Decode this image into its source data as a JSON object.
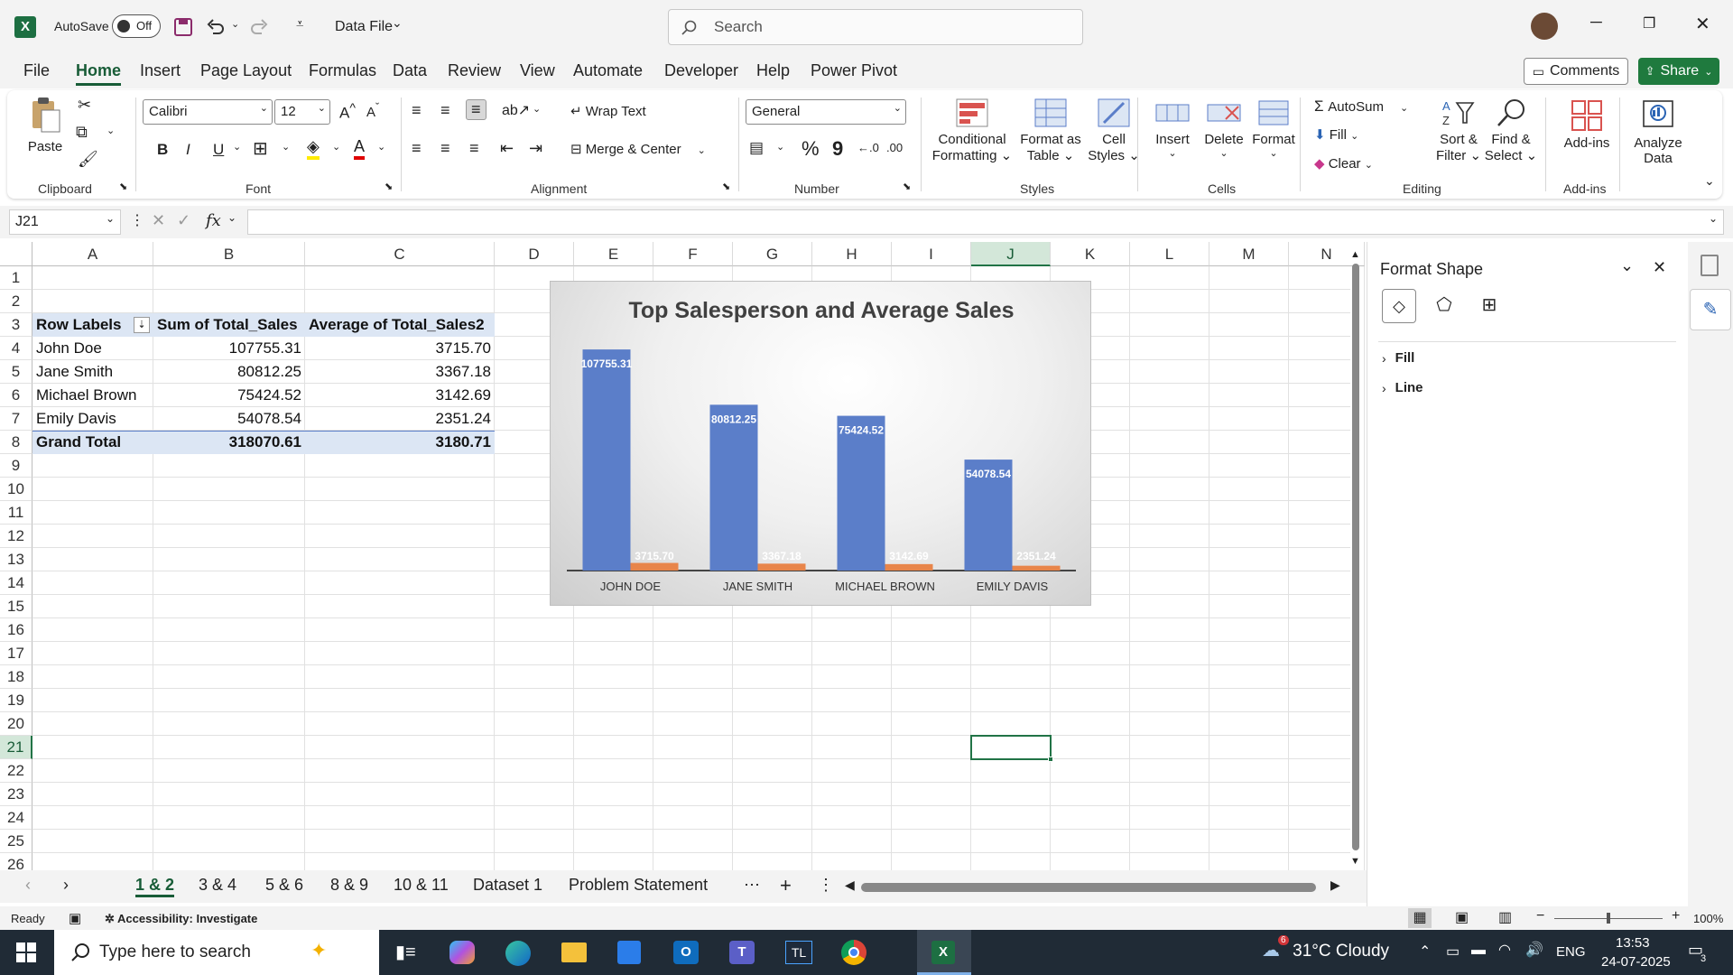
{
  "titlebar": {
    "autosave_label": "AutoSave",
    "autosave_state": "Off",
    "file_name": "Data File",
    "search_placeholder": "Search"
  },
  "menu_tabs": [
    "File",
    "Home",
    "Insert",
    "Page Layout",
    "Formulas",
    "Data",
    "Review",
    "View",
    "Automate",
    "Developer",
    "Help",
    "Power Pivot"
  ],
  "header_buttons": {
    "comments": "Comments",
    "share": "Share"
  },
  "ribbon": {
    "clipboard": {
      "paste": "Paste",
      "group": "Clipboard"
    },
    "font": {
      "name": "Calibri",
      "size": "12",
      "group": "Font",
      "bold": "B",
      "italic": "I",
      "underline": "U"
    },
    "alignment": {
      "wrap": "Wrap Text",
      "merge": "Merge & Center",
      "group": "Alignment"
    },
    "number": {
      "format": "General",
      "group": "Number",
      "percent": "%",
      "comma": "9"
    },
    "styles": {
      "cond1": "Conditional",
      "cond2": "Formatting",
      "fmt1": "Format as",
      "fmt2": "Table",
      "cell1": "Cell",
      "cell2": "Styles",
      "group": "Styles"
    },
    "cells": {
      "insert": "Insert",
      "delete": "Delete",
      "format": "Format",
      "group": "Cells"
    },
    "editing": {
      "autosum": "AutoSum",
      "fill": "Fill",
      "clear": "Clear",
      "sort1": "Sort &",
      "sort2": "Filter",
      "find1": "Find &",
      "find2": "Select",
      "group": "Editing"
    },
    "addins": {
      "label": "Add-ins",
      "group": "Add-ins"
    },
    "analyze": {
      "l1": "Analyze",
      "l2": "Data"
    }
  },
  "formula_bar": {
    "name_box": "J21",
    "fx": "fx",
    "value": ""
  },
  "columns": [
    "A",
    "B",
    "C",
    "D",
    "E",
    "F",
    "G",
    "H",
    "I",
    "J",
    "K",
    "L",
    "M",
    "N"
  ],
  "rows": [
    "1",
    "2",
    "3",
    "4",
    "5",
    "6",
    "7",
    "8",
    "9",
    "10",
    "11",
    "12",
    "13",
    "14",
    "15",
    "16",
    "17",
    "18",
    "19",
    "20",
    "21",
    "22",
    "23",
    "24",
    "25",
    "26"
  ],
  "pivot": {
    "headers": [
      "Row Labels",
      "Sum of Total_Sales",
      "Average of Total_Sales2"
    ],
    "rows": [
      [
        "John Doe",
        "107755.31",
        "3715.70"
      ],
      [
        "Jane Smith",
        "80812.25",
        "3367.18"
      ],
      [
        "Michael Brown",
        "75424.52",
        "3142.69"
      ],
      [
        "Emily Davis",
        "54078.54",
        "2351.24"
      ]
    ],
    "total": [
      "Grand Total",
      "318070.61",
      "3180.71"
    ]
  },
  "chart_data": {
    "type": "bar",
    "title": "Top Salesperson and Average Sales",
    "categories": [
      "JOHN DOE",
      "JANE SMITH",
      "MICHAEL BROWN",
      "EMILY DAVIS"
    ],
    "series": [
      {
        "values": [
          107755.31,
          80812.25,
          75424.52,
          54078.54
        ],
        "labels": [
          "107755.31",
          "80812.25",
          "75424.52",
          "54078.54"
        ],
        "color": "#5b7ec9"
      },
      {
        "values": [
          3715.7,
          3367.18,
          3142.69,
          2351.24
        ],
        "labels": [
          "3715.70",
          "3367.18",
          "3142.69",
          "2351.24"
        ],
        "color": "#e8854a"
      }
    ],
    "ylim": [
      0,
      110000
    ],
    "grid": false,
    "legend": "none"
  },
  "format_panel": {
    "title": "Format Shape",
    "sections": [
      "Fill",
      "Line"
    ]
  },
  "sheet_tabs": [
    "1 & 2",
    "3 & 4",
    "5 & 6",
    "8 & 9",
    "10 & 11",
    "Dataset 1",
    "Problem Statement"
  ],
  "status": {
    "ready": "Ready",
    "accessibility": "Accessibility: Investigate",
    "zoom": "100%"
  },
  "taskbar": {
    "search": "Type here to search",
    "weather": "31°C  Cloudy",
    "lang": "ENG",
    "time": "13:53",
    "date": "24-07-2025",
    "notif_count": "3",
    "weather_badge": "6"
  },
  "colors": {
    "excel_green": "#185c37",
    "selection": "#217346"
  }
}
